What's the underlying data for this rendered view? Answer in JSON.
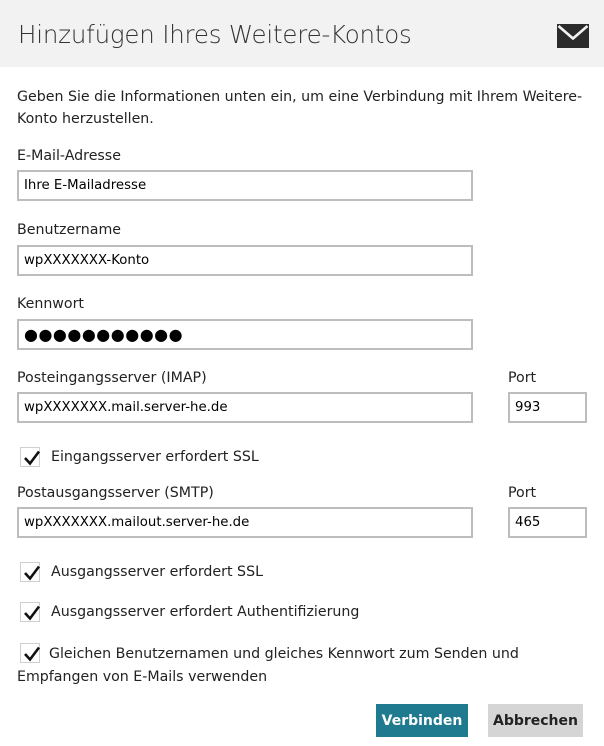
{
  "dialog": {
    "title": "Hinzufügen Ihres Weitere-Kontos",
    "header_icon": "mail-icon",
    "intro": "Geben Sie die Informationen unten ein, um eine Verbindung mit Ihrem Weitere-Konto herzustellen."
  },
  "form": {
    "email": {
      "label": "E-Mail-Adresse",
      "value": "Ihre E-Mailadresse"
    },
    "username": {
      "label": "Benutzername",
      "value": "wpXXXXXXX-Konto"
    },
    "password": {
      "label": "Kennwort",
      "value": "●●●●●●●●●●●"
    },
    "incoming": {
      "label": "Posteingangsserver (IMAP)",
      "value": "wpXXXXXXX.mail.server-he.de",
      "port_label": "Port",
      "port_value": "993",
      "ssl": {
        "label": "Eingangsserver erfordert SSL",
        "checked": true
      }
    },
    "outgoing": {
      "label": "Postausgangsserver (SMTP)",
      "value": "wpXXXXXXX.mailout.server-he.de",
      "port_label": "Port",
      "port_value": "465",
      "ssl": {
        "label": "Ausgangsserver erfordert SSL",
        "checked": true
      },
      "auth": {
        "label": "Ausgangsserver erfordert Authentifizierung",
        "checked": true
      }
    },
    "same_credentials": {
      "label": "Gleichen Benutzernamen und gleiches Kennwort zum Senden und Empfangen von E-Mails verwenden",
      "checked": true
    }
  },
  "actions": {
    "connect_label": "Verbinden",
    "cancel_label": "Abbrechen"
  },
  "colors": {
    "header_bg": "#f2f2f2",
    "primary_button": "#1f7a90",
    "secondary_button": "#d5d5d5",
    "input_border": "#bdbdbd"
  }
}
